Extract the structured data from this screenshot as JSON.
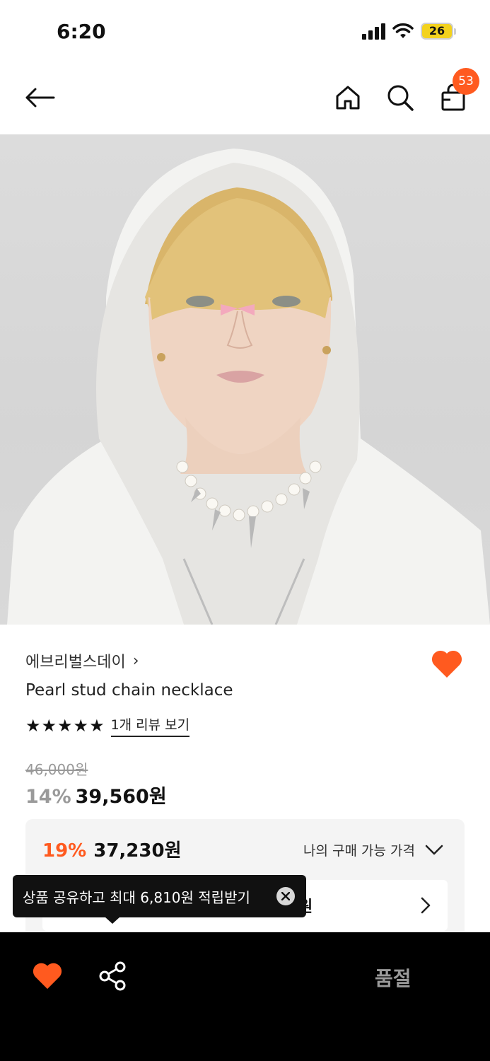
{
  "status_bar": {
    "time": "6:20",
    "battery_level": "26",
    "battery_percent": 26
  },
  "header": {
    "icons": {
      "back": "arrow-left-icon",
      "home": "home-icon",
      "search": "search-icon",
      "cart": "shopping-bag-icon"
    },
    "cart_count": "53"
  },
  "product": {
    "image_alt": "Model wearing pearl stud chain necklace",
    "brand": "에브리벌스데이",
    "brand_chevron": "›",
    "name": "Pearl stud chain necklace",
    "rating_stars": 5,
    "review_link": "1개 리뷰 보기",
    "original_price": "46,000원",
    "discount_rate": "14%",
    "sale_price": "39,560원"
  },
  "my_price": {
    "discount_rate": "19%",
    "price": "37,230원",
    "toggle_label": "나의 구매 가능 가격",
    "coupon_partial_text": "원"
  },
  "tooltip": {
    "text": "상품 공유하고 최대 6,810원 적립받기"
  },
  "bottom_bar": {
    "soldout_label": "품절"
  },
  "colors": {
    "accent": "#ff5a1f",
    "bottom_bar": "#000000",
    "soldout_text": "#9a9a9a"
  }
}
